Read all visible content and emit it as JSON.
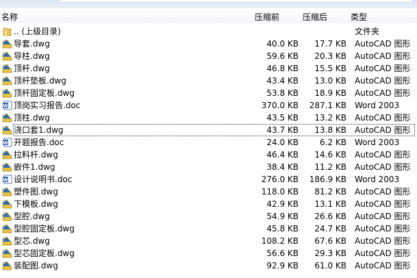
{
  "columns": {
    "name": "名称",
    "before": "压缩前",
    "after": "压缩后",
    "type": "类型"
  },
  "rows": [
    {
      "name": ".. (上级目录)",
      "before": "",
      "after": "",
      "type": "文件夹",
      "icon": "folder"
    },
    {
      "name": "导套.dwg",
      "before": "40.0 KB",
      "after": "17.7 KB",
      "type": "AutoCAD 图形",
      "icon": "dwg"
    },
    {
      "name": "导柱.dwg",
      "before": "59.6 KB",
      "after": "20.3 KB",
      "type": "AutoCAD 图形",
      "icon": "dwg"
    },
    {
      "name": "顶杆.dwg",
      "before": "46.8 KB",
      "after": "15.5 KB",
      "type": "AutoCAD 图形",
      "icon": "dwg"
    },
    {
      "name": "顶杆垫板.dwg",
      "before": "43.4 KB",
      "after": "13.0 KB",
      "type": "AutoCAD 图形",
      "icon": "dwg"
    },
    {
      "name": "顶杆固定板.dwg",
      "before": "53.8 KB",
      "after": "18.9 KB",
      "type": "AutoCAD 图形",
      "icon": "dwg"
    },
    {
      "name": "顶岗实习报告.doc",
      "before": "370.0 KB",
      "after": "287.1 KB",
      "type": "Word 2003",
      "icon": "doc"
    },
    {
      "name": "顶柱.dwg",
      "before": "43.5 KB",
      "after": "13.2 KB",
      "type": "AutoCAD 图形",
      "icon": "dwg"
    },
    {
      "name": "浇口套1.dwg",
      "before": "43.7 KB",
      "after": "13.8 KB",
      "type": "AutoCAD 图形",
      "icon": "dwg"
    },
    {
      "name": "开题报告.doc",
      "before": "24.0 KB",
      "after": "6.2 KB",
      "type": "Word 2003",
      "icon": "doc"
    },
    {
      "name": "拉料杆.dwg",
      "before": "46.4 KB",
      "after": "14.6 KB",
      "type": "AutoCAD 图形",
      "icon": "dwg"
    },
    {
      "name": "嵌件1.dwg",
      "before": "38.4 KB",
      "after": "11.2 KB",
      "type": "AutoCAD 图形",
      "icon": "dwg"
    },
    {
      "name": "设计说明书.doc",
      "before": "276.0 KB",
      "after": "186.9 KB",
      "type": "Word 2003",
      "icon": "doc"
    },
    {
      "name": "塑件图.dwg",
      "before": "118.0 KB",
      "after": "81.2 KB",
      "type": "AutoCAD 图形",
      "icon": "dwg"
    },
    {
      "name": "下模板.dwg",
      "before": "42.9 KB",
      "after": "13.1 KB",
      "type": "AutoCAD 图形",
      "icon": "dwg"
    },
    {
      "name": "型腔.dwg",
      "before": "54.9 KB",
      "after": "26.6 KB",
      "type": "AutoCAD 图形",
      "icon": "dwg"
    },
    {
      "name": "型腔固定板.dwg",
      "before": "45.8 KB",
      "after": "24.7 KB",
      "type": "AutoCAD 图形",
      "icon": "dwg"
    },
    {
      "name": "型芯.dwg",
      "before": "108.2 KB",
      "after": "67.6 KB",
      "type": "AutoCAD 图形",
      "icon": "dwg"
    },
    {
      "name": "型芯固定板.dwg",
      "before": "56.6 KB",
      "after": "29.3 KB",
      "type": "AutoCAD 图形",
      "icon": "dwg"
    },
    {
      "name": "装配图.dwg",
      "before": "92.9 KB",
      "after": "61.0 KB",
      "type": "AutoCAD 图形",
      "icon": "dwg"
    }
  ]
}
